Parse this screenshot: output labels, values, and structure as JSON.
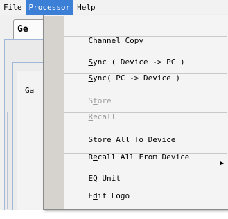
{
  "menubar": {
    "file": "File",
    "processor": "Processor",
    "help": "Help"
  },
  "background": {
    "tab_label": "Ge",
    "group_label": "Ga"
  },
  "processor_menu": {
    "items": [
      {
        "pre": "",
        "ul": "C",
        "post": "hannel Copy",
        "enabled": true
      },
      {
        "pre": "",
        "ul": "S",
        "post": "ync ( Device -> PC )",
        "enabled": true
      },
      {
        "pre": "",
        "ul": "S",
        "post": "ync( PC -> Device )",
        "enabled": true
      },
      {
        "pre": "S",
        "ul": "t",
        "post": "ore",
        "enabled": false
      },
      {
        "pre": "",
        "ul": "R",
        "post": "ecall",
        "enabled": false
      },
      {
        "pre": "St",
        "ul": "o",
        "post": "re All To Device",
        "enabled": true
      },
      {
        "pre": "R",
        "ul": "e",
        "post": "call All From Device",
        "enabled": true
      },
      {
        "pre": "",
        "ul": "EQ",
        "post": " Unit",
        "enabled": true,
        "submenu": true,
        "submenu_glyph": "▶"
      },
      {
        "pre": "E",
        "ul": "d",
        "post": "it Logo",
        "enabled": true
      }
    ]
  }
}
